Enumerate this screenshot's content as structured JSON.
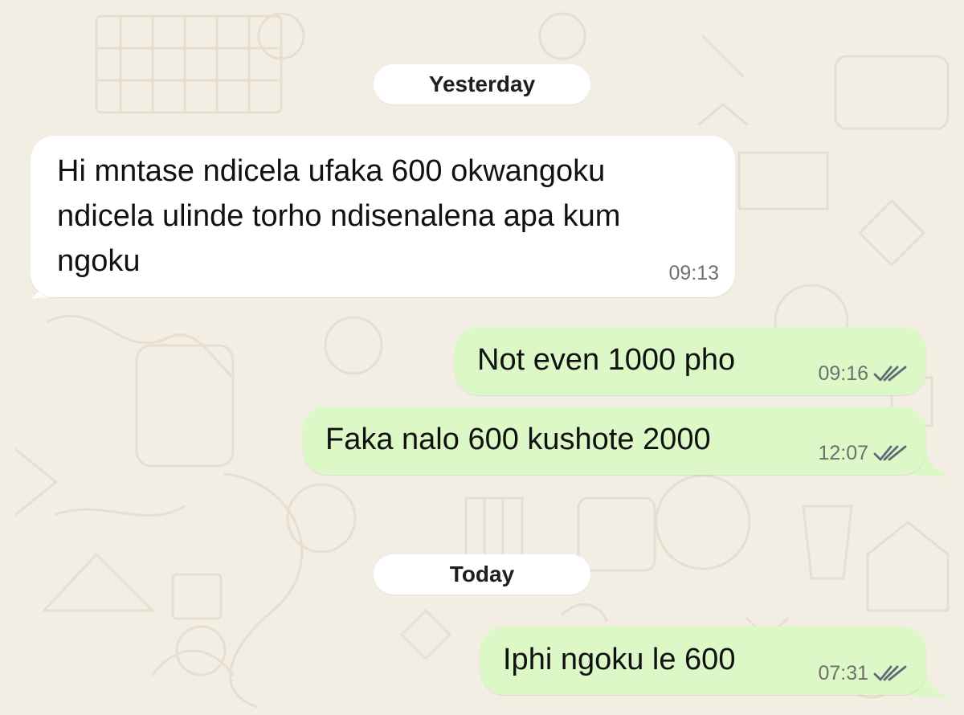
{
  "chat": {
    "date_separators": {
      "yesterday": "Yesterday",
      "today": "Today"
    },
    "messages": [
      {
        "direction": "incoming",
        "lines": [
          "Hi mntase ndicela ufaka 600 okwangoku",
          "ndicela ulinde torho ndisenalena apa kum",
          "ngoku"
        ],
        "time": "09:13"
      },
      {
        "direction": "outgoing",
        "text": "Not even 1000 pho",
        "time": "09:16",
        "status_icon": "double-check-icon"
      },
      {
        "direction": "outgoing",
        "text": "Faka nalo 600 kushote 2000",
        "time": "12:07",
        "status_icon": "double-check-icon"
      },
      {
        "direction": "outgoing",
        "text": "Iphi ngoku le 600",
        "time": "07:31",
        "status_icon": "double-check-icon"
      }
    ]
  },
  "colors": {
    "wallpaper": "#f3eee4",
    "incoming_bubble": "#ffffff",
    "outgoing_bubble": "#dcf8c6",
    "timestamp": "#6f6f6f"
  }
}
